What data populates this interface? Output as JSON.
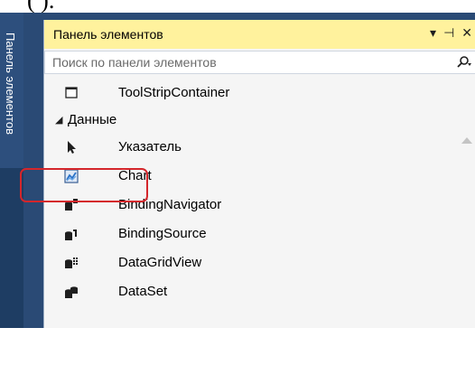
{
  "caption_fragment": "( ).",
  "sidebar": {
    "tab_label": "Панель элементов"
  },
  "toolbox": {
    "title": "Панель элементов",
    "search_placeholder": "Поиск по панели элементов",
    "items_before_group": [
      {
        "label": "ToolStripContainer",
        "icon": "toolstripcontainer-icon"
      }
    ],
    "group": {
      "label": "Данные",
      "expanded": true,
      "items": [
        {
          "label": "Указатель",
          "icon": "pointer-icon"
        },
        {
          "label": "Chart",
          "icon": "chart-icon",
          "highlighted": true
        },
        {
          "label": "BindingNavigator",
          "icon": "bindingnavigator-icon"
        },
        {
          "label": "BindingSource",
          "icon": "bindingsource-icon"
        },
        {
          "label": "DataGridView",
          "icon": "datagridview-icon"
        },
        {
          "label": "DataSet",
          "icon": "dataset-icon"
        }
      ]
    }
  },
  "colors": {
    "title_bar": "#fff29d",
    "frame": "#2a4a75",
    "side_strip": "#1e3d63",
    "highlight": "#d4262b"
  }
}
